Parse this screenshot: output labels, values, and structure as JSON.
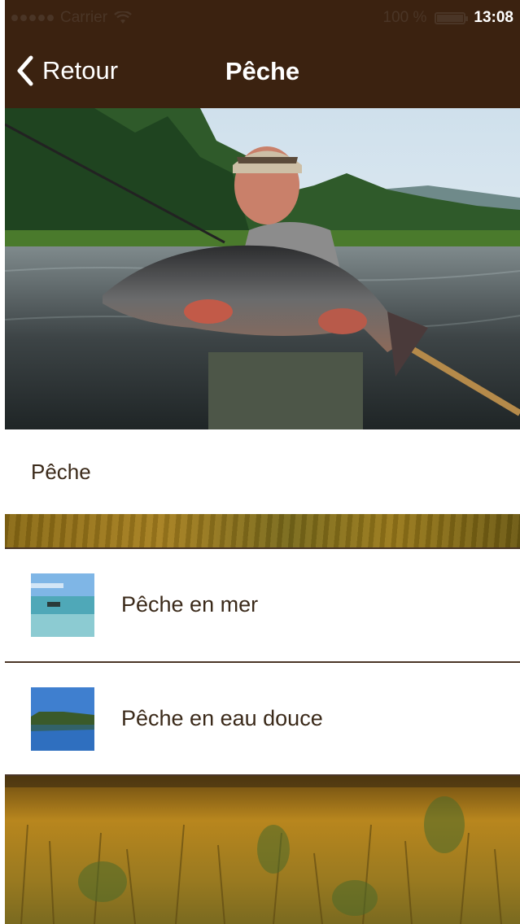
{
  "status_bar": {
    "carrier": "Carrier",
    "battery": "100 %",
    "time": "13:08"
  },
  "nav": {
    "back_label": "Retour",
    "title": "Pêche"
  },
  "section": {
    "title": "Pêche"
  },
  "items": [
    {
      "label": "Pêche en mer",
      "thumbnail": "sea-boat-image"
    },
    {
      "label": "Pêche en eau douce",
      "thumbnail": "lake-forest-image"
    }
  ],
  "colors": {
    "nav_background": "#3b2210",
    "text": "#3b2a1a"
  },
  "icons": {
    "back": "chevron-left-icon",
    "signal": "signal-dots-icon",
    "wifi": "wifi-icon",
    "battery": "battery-icon"
  }
}
